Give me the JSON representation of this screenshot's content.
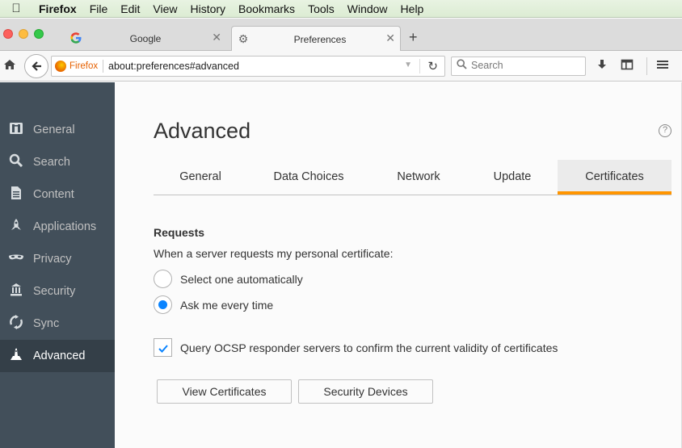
{
  "menubar": {
    "apple": "",
    "items": [
      "Firefox",
      "File",
      "Edit",
      "View",
      "History",
      "Bookmarks",
      "Tools",
      "Window",
      "Help"
    ]
  },
  "tabs": [
    {
      "label": "Google",
      "icon": "google-icon"
    },
    {
      "label": "Preferences",
      "icon": "gear-icon"
    }
  ],
  "navbar": {
    "identity_label": "Firefox",
    "url": "about:preferences#advanced",
    "search_placeholder": "Search"
  },
  "sidebar": {
    "items": [
      {
        "label": "General",
        "icon": "general-icon"
      },
      {
        "label": "Search",
        "icon": "search-icon"
      },
      {
        "label": "Content",
        "icon": "content-icon"
      },
      {
        "label": "Applications",
        "icon": "applications-icon"
      },
      {
        "label": "Privacy",
        "icon": "privacy-mask-icon"
      },
      {
        "label": "Security",
        "icon": "security-icon"
      },
      {
        "label": "Sync",
        "icon": "sync-icon"
      },
      {
        "label": "Advanced",
        "icon": "advanced-icon"
      }
    ],
    "selected": "Advanced"
  },
  "main": {
    "title": "Advanced",
    "tabs": [
      "General",
      "Data Choices",
      "Network",
      "Update",
      "Certificates"
    ],
    "selected_tab": "Certificates",
    "requests_heading": "Requests",
    "requests_desc": "When a server requests my personal certificate:",
    "radio_auto": "Select one automatically",
    "radio_ask": "Ask me every time",
    "ocsp_label": "Query OCSP responder servers to confirm the current validity of certificates",
    "ocsp_checked": true,
    "view_certs_label": "View Certificates",
    "security_devices_label": "Security Devices"
  },
  "colors": {
    "accent": "#ff9500",
    "sidebar_bg": "#424f5a",
    "radio_blue": "#0a84ff"
  }
}
